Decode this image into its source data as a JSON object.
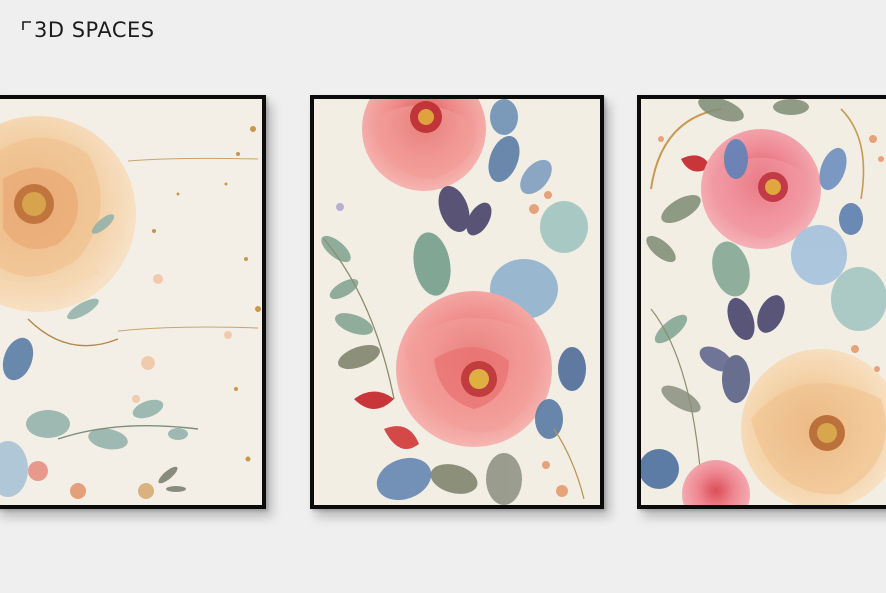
{
  "brand": {
    "name": "3D SPACES",
    "icon": "corner-bracket-icon"
  },
  "scene": {
    "background": "#efefef",
    "frame_color": "#0b0b0b",
    "paper_color": "#f4efe6"
  },
  "artworks": [
    {
      "subject": "peach-rose-watercolor"
    },
    {
      "subject": "pink-rose-bouquet-watercolor"
    },
    {
      "subject": "mixed-roses-watercolor"
    }
  ]
}
